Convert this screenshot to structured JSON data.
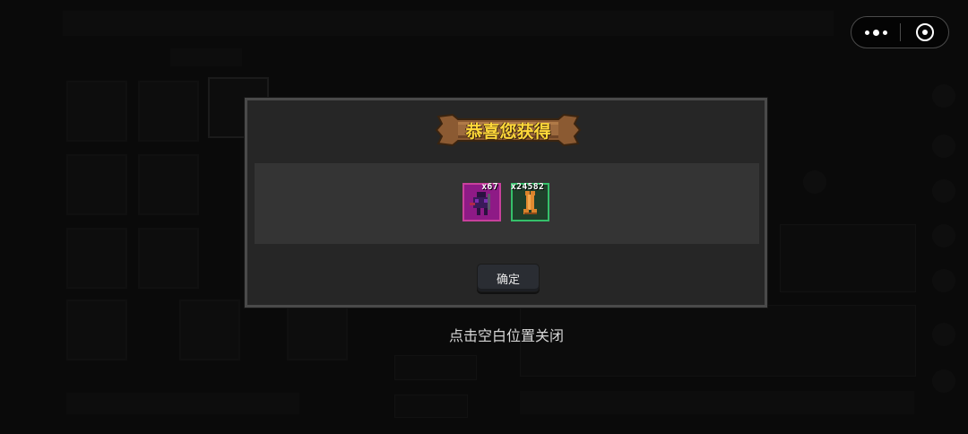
{
  "window": {
    "capsule": {
      "more_icon": "more-dots-icon",
      "close_icon": "target-close-icon"
    }
  },
  "dialog": {
    "title": "恭喜您获得",
    "rewards": [
      {
        "name": "purple-item",
        "icon": "shadow-weapon-icon",
        "count": "x67",
        "rarity_color": "#c8409c"
      },
      {
        "name": "bone-item",
        "icon": "bone-icon",
        "count": "x24582",
        "rarity_color": "#35c06a"
      }
    ],
    "confirm_label": "确定"
  },
  "hint": "点击空白位置关闭",
  "colors": {
    "title": "#ffd83a",
    "banner": "#8b5a32",
    "dialog_bg": "#262626",
    "dialog_border": "#4a4a4a"
  }
}
